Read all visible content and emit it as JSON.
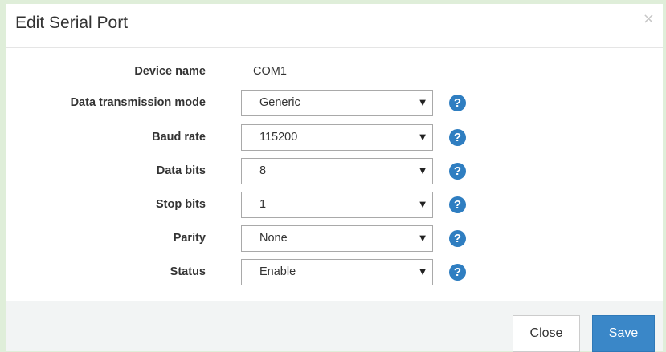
{
  "dialog": {
    "title": "Edit Serial Port",
    "close_icon": "×"
  },
  "form": {
    "device_name": {
      "label": "Device name",
      "value": "COM1"
    },
    "data_transmission_mode": {
      "label": "Data transmission mode",
      "value": "Generic"
    },
    "baud_rate": {
      "label": "Baud rate",
      "value": "115200"
    },
    "data_bits": {
      "label": "Data bits",
      "value": "8"
    },
    "stop_bits": {
      "label": "Stop bits",
      "value": "1"
    },
    "parity": {
      "label": "Parity",
      "value": "None"
    },
    "status": {
      "label": "Status",
      "value": "Enable"
    }
  },
  "icons": {
    "dropdown_arrow": "▼",
    "help": "?"
  },
  "footer": {
    "close_label": "Close",
    "save_label": "Save"
  },
  "colors": {
    "accent": "#3a87c8",
    "help_icon": "#2f7ec1",
    "page_background": "#dfeed9"
  }
}
